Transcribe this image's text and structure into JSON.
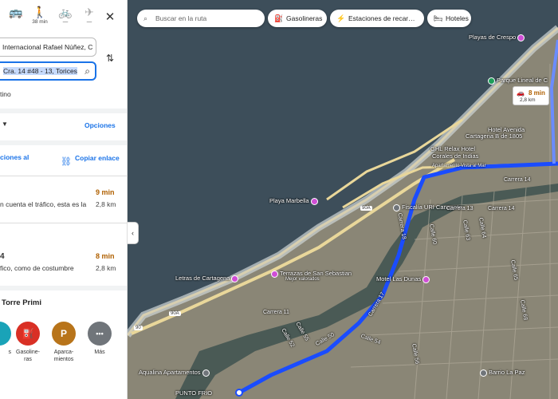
{
  "modes": [
    {
      "name": "transit-icon",
      "glyph": "🚌",
      "sub": ""
    },
    {
      "name": "walk-icon",
      "glyph": "🚶",
      "sub": "38 min"
    },
    {
      "name": "bike-icon",
      "glyph": "🚲",
      "sub": "—"
    },
    {
      "name": "flight-icon",
      "glyph": "✈",
      "sub": "—"
    }
  ],
  "origin": "Internacional Rafael Núñez, C",
  "destination": "Cra. 14 #48 - 13, Torices",
  "add_stop": "tino",
  "options_label": "Opciones",
  "share": {
    "send_label": "ciones al",
    "copy_label": "Copiar enlace"
  },
  "routes": [
    {
      "desc": "n cuenta el tráfico, esta es la",
      "time": "9 min",
      "dist": "2,8 km"
    },
    {
      "title": "4",
      "desc": "fico, como de costumbre",
      "time": "8 min",
      "dist": "2,8 km"
    }
  ],
  "nearby": {
    "title": "Torre Primi",
    "items": [
      {
        "label": "s",
        "glyph": "",
        "color": "#1aa3b8"
      },
      {
        "label": "Gasoline-ras",
        "line1": "Gasoline-",
        "line2": "ras",
        "glyph": "⛽",
        "color": "#d93025"
      },
      {
        "label": "Aparca-mientos",
        "line1": "Aparca-",
        "line2": "mientos",
        "glyph": "P",
        "color": "#b8741a"
      },
      {
        "label": "Más",
        "line1": "Más",
        "line2": "",
        "glyph": "•••",
        "color": "#70757a"
      }
    ]
  },
  "map_chips": {
    "search_placeholder": "Buscar en la ruta",
    "gas": "Gasolineras",
    "charging": "Estaciones de recar…",
    "hotels": "Hoteles"
  },
  "map_badge": {
    "time": "8 min",
    "dist": "2,8 km"
  },
  "pois": {
    "playas_crespo": "Playas de Crespo",
    "parque_lineal": "Parque Lineal de C",
    "hotel_avenida": "Hotel Avenida",
    "cartagena_1805": "Cartagena B de 1805",
    "ghl_relax": "GHL Relax Hotel",
    "corales": "Corales de Indias",
    "vista_mar": "Apartamento Vista al Mar",
    "playa_marbella": "Playa Marbella",
    "fiscalia": "Fiscalía URI Canapote",
    "terrazas": "Terrazas de San Sebastian",
    "terrazas_sub": "Mejor valorados",
    "letras": "Letras de Cartagena",
    "motel": "Motel Las Dunas",
    "aqualina": "Aqualina Apartamentos",
    "punto_frio": "PUNTO FRIO",
    "barrio_paz": "Barrio La Paz"
  },
  "streets": {
    "carrera14": "Carrera 14",
    "carrera13": "Carrera 13",
    "calle60": "Calle 60",
    "calle63": "Calle 63",
    "calle64": "Calle 64",
    "calle65": "Calle 65",
    "calle68": "Calle 68",
    "carrera17": "Carrera 17",
    "carrera18": "Carrera 18",
    "calle50": "Calle 50",
    "calle54": "Calle 54",
    "calle56": "Calle 56",
    "carrera11": "Carrera 11",
    "calle55": "Calle 55",
    "calle52": "Calle 52",
    "shield_90a": "90A",
    "shield_90a_b": "90A",
    "shield_90": "90"
  },
  "colors": {
    "route": "#1a4cff",
    "accent": "#1a73e8",
    "time": "#b06000",
    "sea": "#3d4e5a"
  }
}
